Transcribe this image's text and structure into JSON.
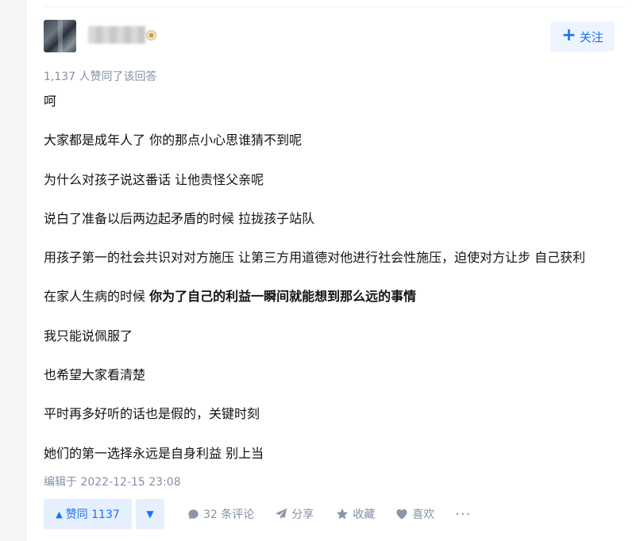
{
  "author": {
    "name": "██████",
    "avatar_icon": "user-avatar",
    "badge_icon": "creator-badge-icon"
  },
  "follow_button": {
    "label": "关注",
    "icon": "plus-icon"
  },
  "vote_meta": "1,137 人赞同了该回答",
  "content": {
    "paragraphs": [
      "呵",
      "大家都是成年人了 你的那点小心思谁猜不到呢",
      "为什么对孩子说这番话 让他责怪父亲呢",
      "说白了准备以后两边起矛盾的时候 拉拢孩子站队",
      "用孩子第一的社会共识对对方施压 让第三方用道德对他进行社会性施压，迫使对方让步 自己获利",
      "在家人生病的时候 ",
      "我只能说佩服了",
      "也希望大家看清楚",
      "平时再多好听的话也是假的，关键时刻",
      "她们的第一选择永远是自身利益 别上当"
    ],
    "bold_segment": "你为了自己的利益一瞬间就能想到那么远的事情"
  },
  "edit_time": "编辑于 2022-12-15 23:08",
  "actions": {
    "vote_up": "赞同 1137",
    "vote_up_icon": "triangle-up-icon",
    "vote_down_icon": "triangle-down-icon",
    "comment": "32 条评论",
    "comment_icon": "comment-bubble-icon",
    "share": "分享",
    "share_icon": "paper-plane-icon",
    "favorite": "收藏",
    "favorite_icon": "star-icon",
    "like": "喜欢",
    "like_icon": "heart-icon",
    "more": "···"
  },
  "colors": {
    "accent": "#1772f6",
    "accent_bg": "#e5effe",
    "meta_text": "#8590a6",
    "body_text": "#121212"
  }
}
